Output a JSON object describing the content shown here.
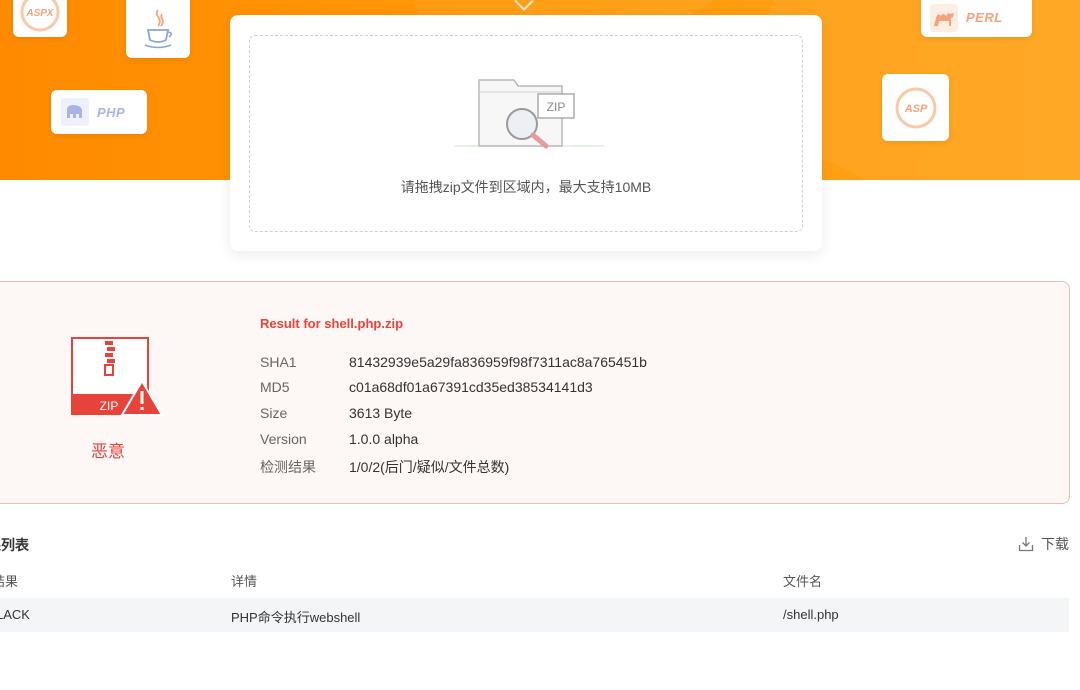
{
  "hero": {
    "languages": [
      {
        "name": "aspx",
        "label": "ASPX"
      },
      {
        "name": "java",
        "label": ""
      },
      {
        "name": "php",
        "label": "PHP"
      },
      {
        "name": "perl",
        "label": "PERL"
      },
      {
        "name": "asp",
        "label": "ASP"
      }
    ],
    "colors": {
      "orange": "#ff9000",
      "accent_red": "#e8433a"
    }
  },
  "upload": {
    "zip_badge": "ZIP",
    "hint": "请拖拽zip文件到区域内，最大支持10MB"
  },
  "result": {
    "title": "Result for shell.php.zip",
    "file_badge": "ZIP",
    "verdict": "恶意",
    "fields": [
      {
        "key": "SHA1",
        "value": "81432939e5a29fa836959f98f7311ac8a765451b"
      },
      {
        "key": "MD5",
        "value": "c01a68df01a67391cd35ed38534141d3"
      },
      {
        "key": "Size",
        "value": "3613 Byte"
      },
      {
        "key": "Version",
        "value": "1.0.0 alpha"
      },
      {
        "key": "检测结果",
        "value": "1/0/2(后门/疑似/文件总数)"
      }
    ]
  },
  "list": {
    "title": "果列表",
    "download_label": "下载",
    "columns": [
      "结果",
      "详情",
      "文件名"
    ],
    "rows": [
      {
        "result": "LACK",
        "detail": "PHP命令执行webshell",
        "filename": "/shell.php"
      }
    ]
  }
}
